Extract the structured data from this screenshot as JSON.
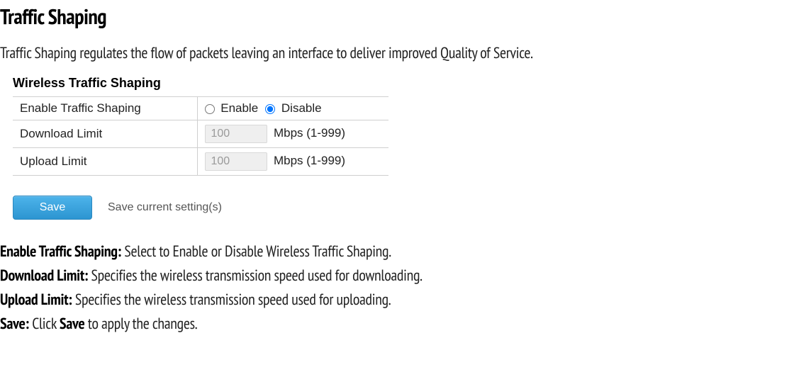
{
  "title": "Traffic Shaping",
  "intro": "Traffic Shaping regulates the flow of packets leaving an interface to deliver improved Quality of Service.",
  "panel": {
    "heading": "Wireless Traffic Shaping",
    "rows": {
      "enable": {
        "label": "Enable Traffic Shaping",
        "option_enable": "Enable",
        "option_disable": "Disable",
        "selected": "disable"
      },
      "download": {
        "label": "Download Limit",
        "value": "100",
        "unit": "Mbps (1-999)"
      },
      "upload": {
        "label": "Upload Limit",
        "value": "100",
        "unit": "Mbps (1-999)"
      }
    },
    "save_button": "Save",
    "save_description": "Save current setting(s)"
  },
  "definitions": {
    "enable": {
      "term": "Enable Traffic Shaping:",
      "desc": " Select to Enable or Disable Wireless Traffic Shaping."
    },
    "download": {
      "term": "Download Limit:",
      "desc": " Specifies the wireless transmission speed used for downloading."
    },
    "upload": {
      "term": "Upload Limit:",
      "desc": " Specifies the wireless transmission speed used for uploading."
    },
    "save": {
      "term": "Save:",
      "desc_pre": " Click ",
      "desc_bold": "Save",
      "desc_post": " to apply the changes."
    }
  }
}
